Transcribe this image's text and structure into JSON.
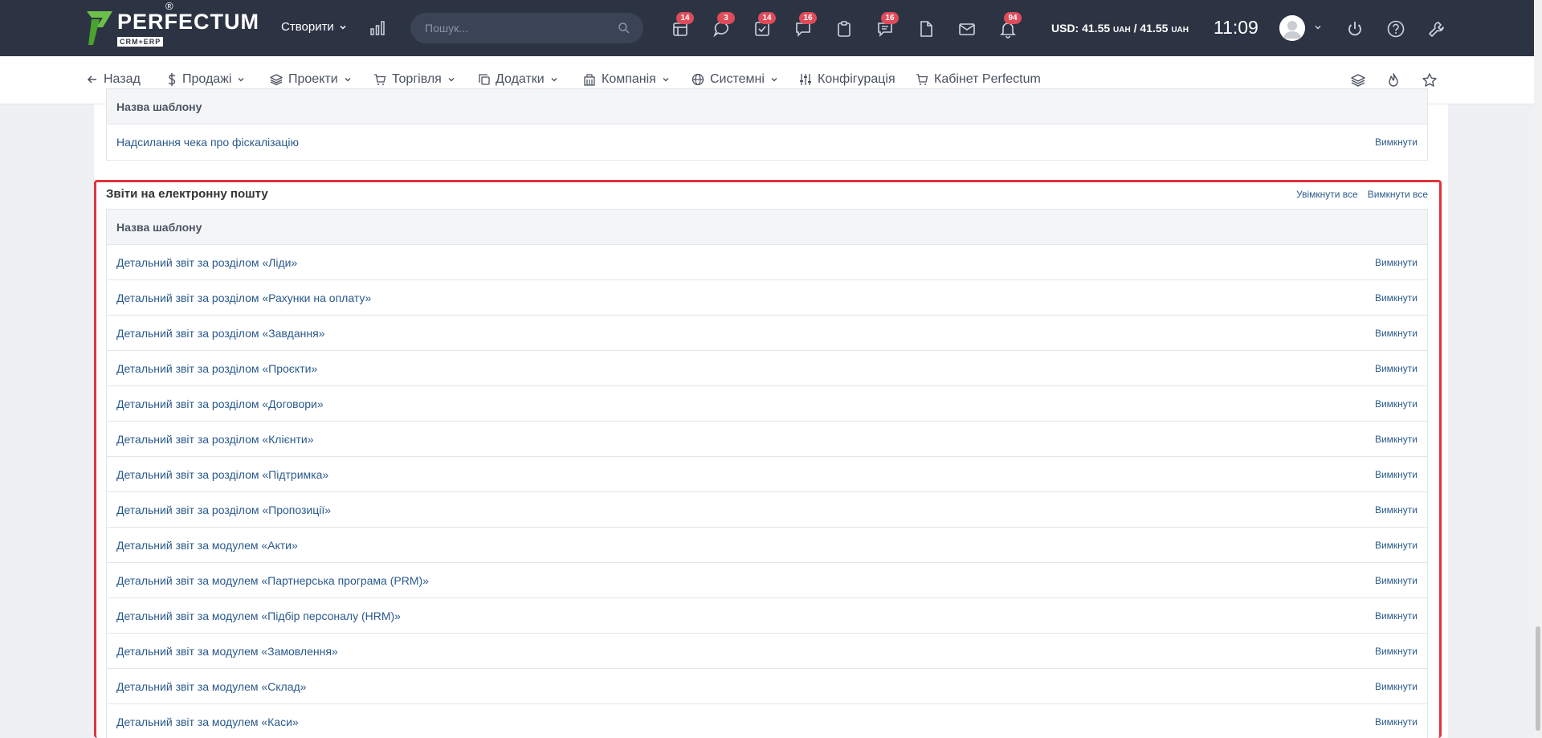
{
  "brand": {
    "name": "PERFECTUM",
    "reg": "®",
    "sub": "CRM+ERP"
  },
  "header": {
    "create_label": "Створити",
    "search_placeholder": "Пошук...",
    "badges": {
      "b1": "14",
      "b2": "3",
      "b3": "14",
      "b4": "16",
      "b5": "16",
      "b6": "94"
    },
    "currency_usd": "USD: 41.55",
    "currency_uah1": "UAH",
    "currency_sep": " / 41.55",
    "currency_uah2": "UAH",
    "time": "11:09"
  },
  "nav": {
    "back": "Назад",
    "sales": "Продажі",
    "projects": "Проекти",
    "trade": "Торгівля",
    "addons": "Додатки",
    "company": "Компанія",
    "system": "Системні",
    "config": "Конфігурація",
    "cabinet": "Кабінет Perfectum"
  },
  "top_table": {
    "header": "Назва шаблону",
    "rows": [
      {
        "name": "Надсилання чека про фіскалізацію",
        "action": "Вимкнути"
      }
    ]
  },
  "email_reports": {
    "title": "Звіти на електронну пошту",
    "enable_all": "Увімкнути все",
    "disable_all": "Вимкнути все",
    "header": "Назва шаблону",
    "rows": [
      {
        "name": "Детальний звіт за розділом «Ліди»",
        "action": "Вимкнути"
      },
      {
        "name": "Детальний звіт за розділом «Рахунки на оплату»",
        "action": "Вимкнути"
      },
      {
        "name": "Детальний звіт за розділом «Завдання»",
        "action": "Вимкнути"
      },
      {
        "name": "Детальний звіт за розділом «Проєкти»",
        "action": "Вимкнути"
      },
      {
        "name": "Детальний звіт за розділом «Договори»",
        "action": "Вимкнути"
      },
      {
        "name": "Детальний звіт за розділом «Клієнти»",
        "action": "Вимкнути"
      },
      {
        "name": "Детальний звіт за розділом «Підтримка»",
        "action": "Вимкнути"
      },
      {
        "name": "Детальний звіт за розділом «Пропозиції»",
        "action": "Вимкнути"
      },
      {
        "name": "Детальний звіт за модулем «Акти»",
        "action": "Вимкнути"
      },
      {
        "name": "Детальний звіт за модулем «Партнерська програма (PRM)»",
        "action": "Вимкнути"
      },
      {
        "name": "Детальний звіт за модулем «Підбір персоналу (HRM)»",
        "action": "Вимкнути"
      },
      {
        "name": "Детальний звіт за модулем «Замовлення»",
        "action": "Вимкнути"
      },
      {
        "name": "Детальний звіт за модулем «Склад»",
        "action": "Вимкнути"
      },
      {
        "name": "Детальний звіт за модулем «Каси»",
        "action": "Вимкнути"
      }
    ]
  },
  "colors": {
    "topbar": "#2c3444",
    "link": "#2a5a8c",
    "highlight": "#e0323f",
    "badge": "#e04b5a"
  }
}
